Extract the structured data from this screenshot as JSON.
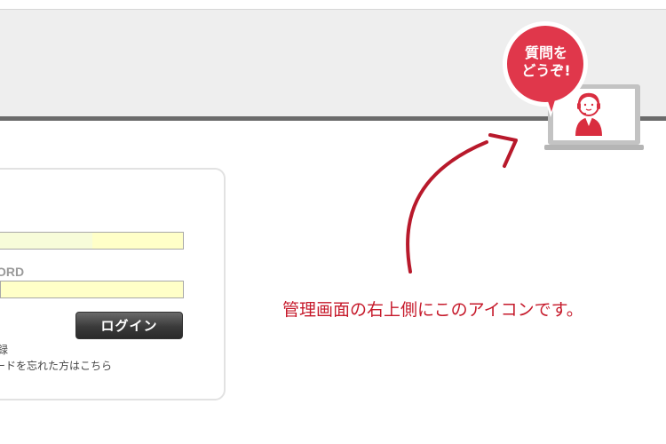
{
  "header": {
    "help_badge": {
      "line1": "質問を",
      "line2": "どうぞ!",
      "icon": "headset-operator-laptop-icon"
    }
  },
  "login": {
    "username_value": "",
    "password_label": "ORD",
    "password_value": "",
    "login_button": "ログイン",
    "remember_text": "録",
    "forgot_link": "ードを忘れた方はこちら"
  },
  "annotation": {
    "text": "管理画面の右上側にこのアイコンです。",
    "arrow_icon": "curved-arrow-icon"
  },
  "colors": {
    "accent_red": "#c61a2b",
    "badge_red": "#e0374b",
    "input_yellow": "#ffffc8",
    "header_gray": "#eeeeee"
  }
}
